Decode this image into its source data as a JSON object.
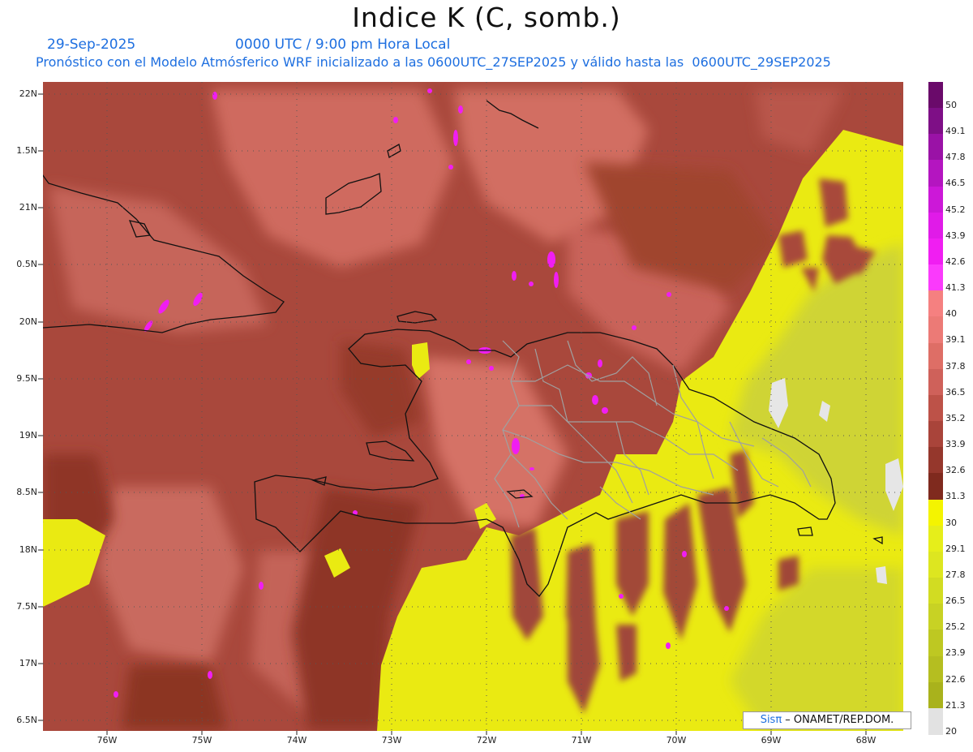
{
  "title": "Indice K (C, somb.)",
  "date": "29-Sep-2025",
  "time": "0000 UTC / 9:00 pm Hora Local",
  "description": "Pronóstico con el Modelo Atmósferico WRF inicializado a las 0600UTC_27SEP2025 y válido hasta las  0600UTC_29SEP2025",
  "lat_labels": [
    "22N",
    "1.5N",
    "21N",
    "0.5N",
    "20N",
    "9.5N",
    "19N",
    "8.5N",
    "18N",
    "7.5N",
    "17N",
    "6.5N"
  ],
  "lon_labels": [
    "76W",
    "75W",
    "74W",
    "73W",
    "72W",
    "71W",
    "70W",
    "69W",
    "68W"
  ],
  "colorbar": {
    "labels": [
      "50",
      "49.1",
      "47.8",
      "46.5",
      "45.2",
      "43.9",
      "42.6",
      "41.3",
      "40",
      "39.1",
      "37.8",
      "36.5",
      "35.2",
      "33.9",
      "32.6",
      "31.3",
      "30",
      "29.1",
      "27.8",
      "26.5",
      "25.2",
      "23.9",
      "22.6",
      "21.3",
      "20"
    ],
    "colors": [
      "#6a0a6a",
      "#7e0f86",
      "#9a12a6",
      "#b415c0",
      "#cc18d8",
      "#e01be8",
      "#f01ef2",
      "#fa3afc",
      "#f58080",
      "#ec7a76",
      "#de6e66",
      "#cf615a",
      "#bd5248",
      "#a9443a",
      "#95372c",
      "#7f2a1e",
      "#f4f400",
      "#e6ee1a",
      "#dde620",
      "#d2dc22",
      "#c8d224",
      "#bec822",
      "#b5be20",
      "#a9b21c",
      "#e2e2e2"
    ]
  },
  "credit": {
    "brand": "Sisπ",
    "text": " – ONAMET/REP.DOM."
  }
}
